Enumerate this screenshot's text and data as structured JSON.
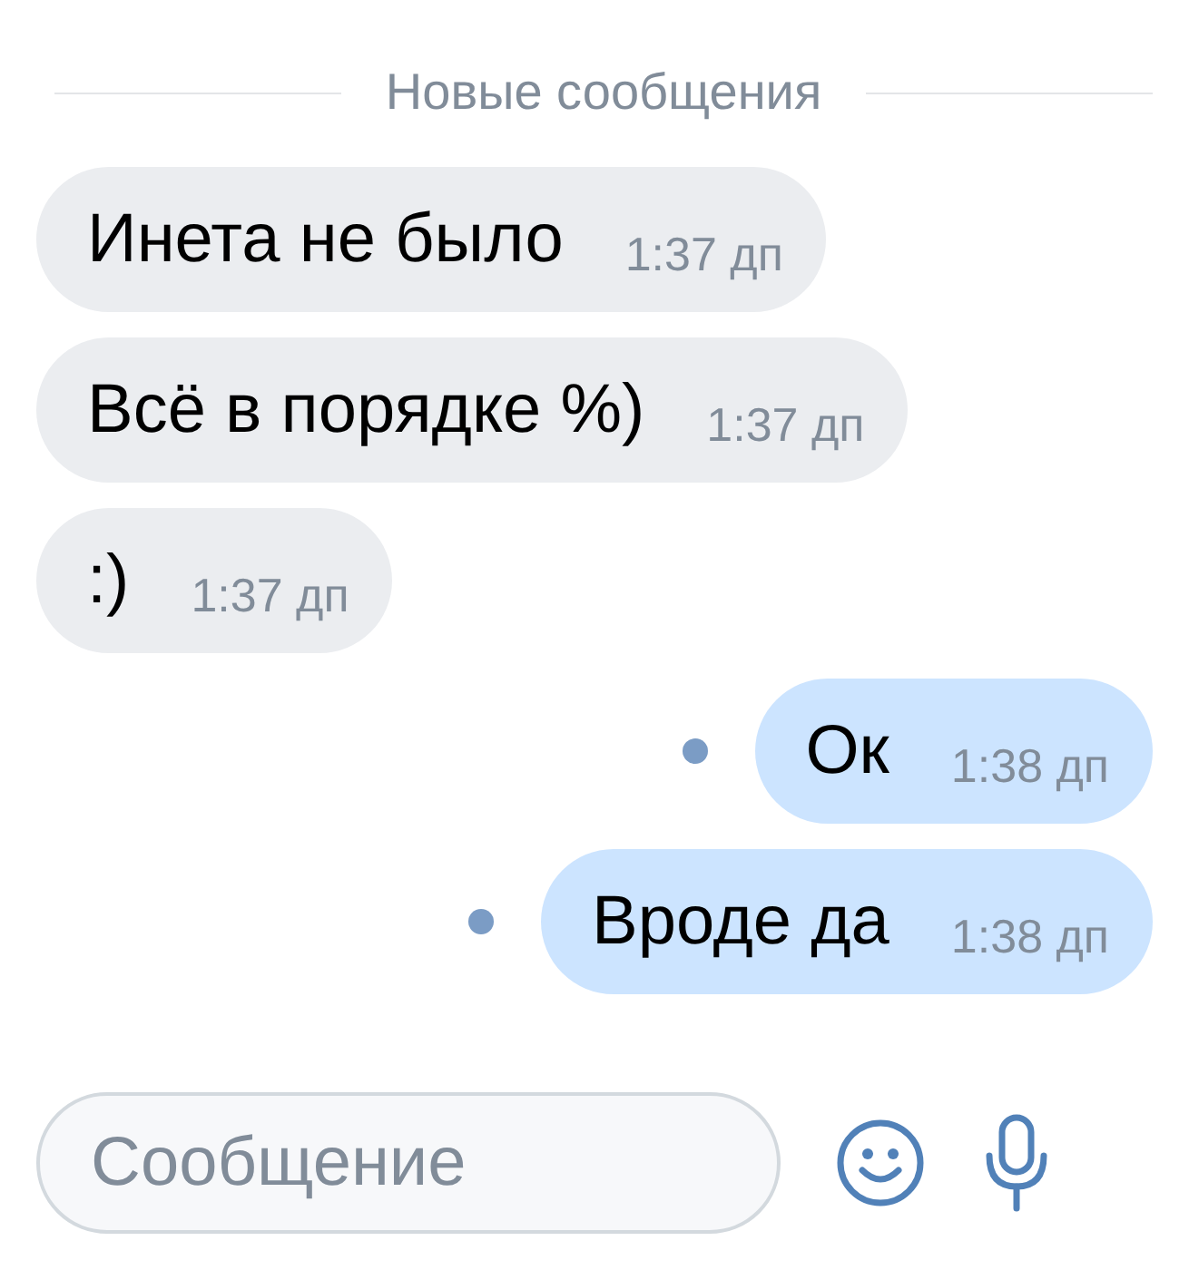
{
  "divider": {
    "label": "Новые сообщения"
  },
  "messages": [
    {
      "outgoing": false,
      "text": "Инета не было",
      "time": "1:37 дп",
      "unread": false
    },
    {
      "outgoing": false,
      "text": "Всё в порядке %)",
      "time": "1:37 дп",
      "unread": false
    },
    {
      "outgoing": false,
      "text": ":)",
      "time": "1:37 дп",
      "unread": false
    },
    {
      "outgoing": true,
      "text": "Ок",
      "time": "1:38 дп",
      "unread": true
    },
    {
      "outgoing": true,
      "text": "Вроде да",
      "time": "1:38 дп",
      "unread": true
    }
  ],
  "composer": {
    "placeholder": "Сообщение"
  }
}
